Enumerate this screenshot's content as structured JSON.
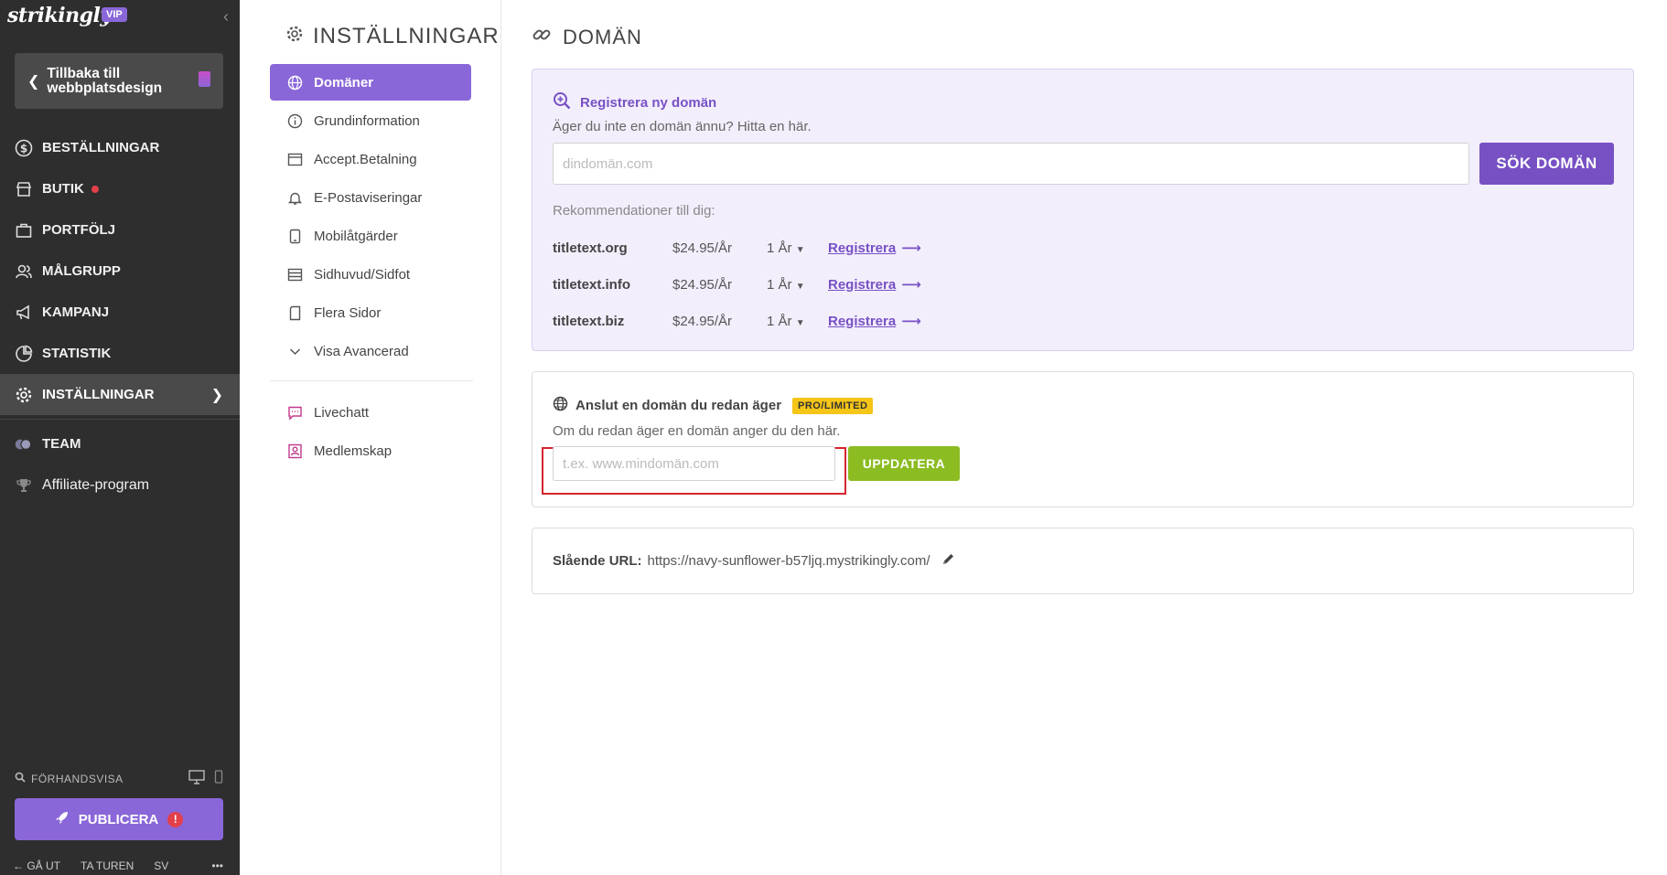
{
  "sidebar": {
    "logo": "strikingly",
    "vip_badge": "VIP",
    "back_button": "Tillbaka till webbplatsdesign",
    "items": [
      {
        "label": "BESTÄLLNINGAR",
        "icon": "dollar-circle-icon"
      },
      {
        "label": "BUTIK",
        "icon": "store-icon",
        "notification_dot": true
      },
      {
        "label": "PORTFÖLJ",
        "icon": "briefcase-icon"
      },
      {
        "label": "MÅLGRUPP",
        "icon": "users-icon"
      },
      {
        "label": "KAMPANJ",
        "icon": "megaphone-icon"
      },
      {
        "label": "STATISTIK",
        "icon": "pie-chart-icon"
      },
      {
        "label": "INSTÄLLNINGAR",
        "icon": "gear-icon",
        "active": true
      }
    ],
    "team_label": "TEAM",
    "affiliate_label": "Affiliate-program",
    "preview_label": "FÖRHANDSVISA",
    "publish_label": "PUBLICERA",
    "footer": {
      "exit": "GÅ UT",
      "tour": "TA TUREN",
      "lang": "SV",
      "more": "•••"
    }
  },
  "settings_menu": {
    "title": "INSTÄLLNINGAR",
    "items": [
      {
        "label": "Domäner",
        "icon": "globe-icon",
        "active": true
      },
      {
        "label": "Grundinformation",
        "icon": "info-icon"
      },
      {
        "label": "Accept.Betalning",
        "icon": "payment-icon"
      },
      {
        "label": "E-Postaviseringar",
        "icon": "bell-icon"
      },
      {
        "label": "Mobilåtgärder",
        "icon": "mobile-icon"
      },
      {
        "label": "Sidhuvud/Sidfot",
        "icon": "layout-icon"
      },
      {
        "label": "Flera Sidor",
        "icon": "pages-icon"
      },
      {
        "label": "Visa Avancerad",
        "icon": "chevron-down-icon"
      }
    ],
    "extra_items": [
      {
        "label": "Livechatt",
        "icon": "chat-icon"
      },
      {
        "label": "Medlemskap",
        "icon": "member-icon"
      }
    ]
  },
  "main": {
    "title": "DOMÄN",
    "register": {
      "heading": "Registrera ny domän",
      "subtext": "Äger du inte en domän ännu? Hitta en här.",
      "input_placeholder": "dindomän.com",
      "search_button": "SÖK DOMÄN",
      "recommend_label": "Rekommendationer till dig:",
      "recommendations": [
        {
          "domain": "titletext.org",
          "price": "$24.95/År",
          "duration": "1 År",
          "action": "Registrera"
        },
        {
          "domain": "titletext.info",
          "price": "$24.95/År",
          "duration": "1 År",
          "action": "Registrera"
        },
        {
          "domain": "titletext.biz",
          "price": "$24.95/År",
          "duration": "1 År",
          "action": "Registrera"
        }
      ]
    },
    "connect": {
      "heading": "Anslut en domän du redan äger",
      "badge": "PRO/LIMITED",
      "subtext": "Om du redan äger en domän anger du den här.",
      "input_placeholder": "t.ex. www.mindomän.com",
      "update_button": "UPPDATERA"
    },
    "url": {
      "label": "Slående URL:",
      "value": "https://navy-sunflower-b57ljq.mystrikingly.com/"
    }
  },
  "colors": {
    "sidebar_bg": "#2e2e2e",
    "accent_purple": "#8a67d8",
    "update_green": "#8bbc22",
    "highlight_red": "#d6252e",
    "badge_yellow": "#f5c518"
  }
}
